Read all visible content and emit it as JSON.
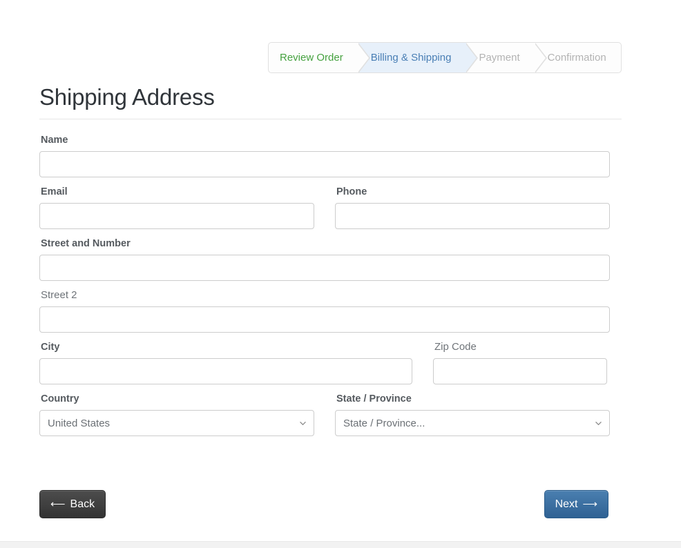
{
  "steps": {
    "items": [
      {
        "label": "Review Order",
        "state": "done",
        "color": "#45a13f"
      },
      {
        "label": "Billing & Shipping",
        "state": "active",
        "color": "#4a7fb5",
        "bg": "#e7f0fa"
      },
      {
        "label": "Payment",
        "state": "todo",
        "color": "#b3b3b3"
      },
      {
        "label": "Confirmation",
        "state": "todo",
        "color": "#b3b3b3"
      }
    ]
  },
  "heading": {
    "title": "Shipping Address"
  },
  "form": {
    "name": {
      "label": "Name",
      "value": "",
      "placeholder": ""
    },
    "email": {
      "label": "Email",
      "value": "",
      "placeholder": ""
    },
    "phone": {
      "label": "Phone",
      "value": "",
      "placeholder": ""
    },
    "street": {
      "label": "Street and Number",
      "value": "",
      "placeholder": ""
    },
    "street2": {
      "label": "Street 2",
      "value": "",
      "placeholder": ""
    },
    "city": {
      "label": "City",
      "value": "",
      "placeholder": ""
    },
    "zip": {
      "label": "Zip Code",
      "value": "",
      "placeholder": ""
    },
    "country": {
      "label": "Country",
      "selected": "United States",
      "icon": "chevron-down-icon"
    },
    "state": {
      "label": "State / Province",
      "selected": "State / Province...",
      "icon": "chevron-down-icon"
    }
  },
  "buttons": {
    "back": {
      "label": "Back",
      "arrow": "⟵",
      "icon": "arrow-left-icon"
    },
    "next": {
      "label": "Next",
      "arrow": "⟶",
      "icon": "arrow-right-icon"
    }
  }
}
